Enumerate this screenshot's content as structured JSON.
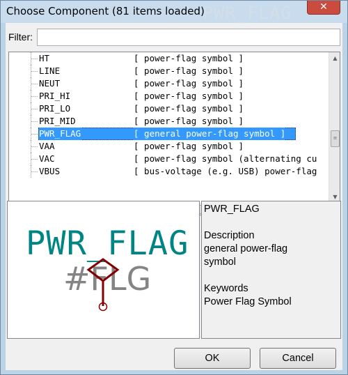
{
  "window": {
    "title": "Choose Component (81 items loaded)",
    "title_ghost": "PWR_FLAG",
    "close_glyph": "✕"
  },
  "filter": {
    "label": "Filter:",
    "value": "",
    "placeholder": ""
  },
  "components": [
    {
      "name": "HT",
      "description": "[ power-flag symbol ]"
    },
    {
      "name": "LINE",
      "description": "[ power-flag symbol ]"
    },
    {
      "name": "NEUT",
      "description": "[ power-flag symbol ]"
    },
    {
      "name": "PRI_HI",
      "description": "[ power-flag symbol ]"
    },
    {
      "name": "PRI_LO",
      "description": "[ power-flag symbol ]"
    },
    {
      "name": "PRI_MID",
      "description": "[ power-flag symbol ]"
    },
    {
      "name": "PWR_FLAG",
      "description": "[ general power-flag symbol ]",
      "selected": true
    },
    {
      "name": "VAA",
      "description": "[ power-flag symbol ]"
    },
    {
      "name": "VAC",
      "description": "[ power-flag symbol (alternating cu"
    },
    {
      "name": "VBUS",
      "description": "[ bus-voltage (e.g. USB) power-flag"
    }
  ],
  "preview": {
    "symbol_name": "PWR_FLAG",
    "symbol_ref": "#FLG",
    "name_color": "#008484",
    "ref_color": "#848484",
    "body_color": "#840000"
  },
  "info": {
    "name": "PWR_FLAG",
    "description_heading": "Description",
    "description_line1": "general power-flag",
    "description_line2": "symbol",
    "keywords_heading": "Keywords",
    "keywords": "Power Flag Symbol"
  },
  "buttons": {
    "ok": "OK",
    "cancel": "Cancel"
  },
  "colors": {
    "selection": "#3399ff",
    "close_button": "#c94c3f"
  }
}
